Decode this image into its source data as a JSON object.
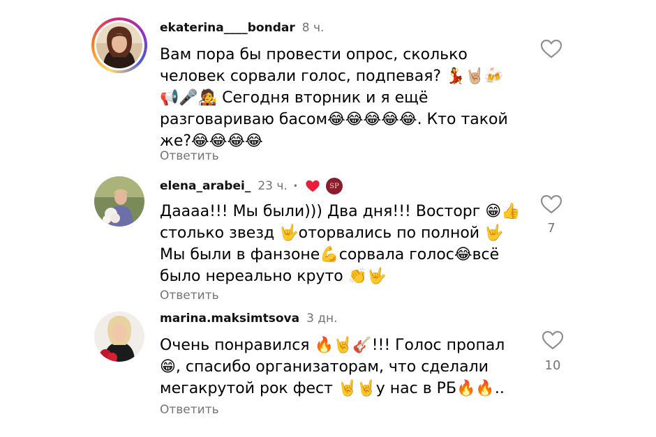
{
  "comments": [
    {
      "username": "ekaterina____bondar",
      "time": "8 ч.",
      "text": "Вам пора бы провести опрос, сколько человек сорвали голос, подпевая? 💃🤘🏼🍻 📢🎤🧑‍🎤 Сегодня вторник и я ещё разговариваю басом😂😂😂😂😂. Кто такой же?😂😂😂😂",
      "reply": "Ответить",
      "likes": "",
      "avatar_icon": "woman-portrait"
    },
    {
      "username": "elena_arabei_",
      "time": "23 ч.",
      "dot": "•",
      "creator_badge": "SP",
      "text": "Даааа!!! Мы были))) Два дня!!! Восторг 😁👍 столько звезд 🤟оторвались по полной 🤟 Мы были в фанзоне💪сорвала голос😂всё было нереально круто 👏🤟",
      "reply": "Ответить",
      "likes": "7",
      "avatar_icon": "woman-with-flowers"
    },
    {
      "username": "marina.maksimtsova",
      "time": "3 дн.",
      "text": "Очень понравился 🔥🤘🎸!!! Голос пропал 😁, спасибо организаторам, что сделали мегакрутой рок фест 🤘🤘у нас в РБ🔥🔥..",
      "reply": "Ответить",
      "likes": "10",
      "avatar_icon": "woman-with-roses"
    }
  ],
  "colors": {
    "secondary_text": "#737373",
    "liked_heart": "#ed1c3b",
    "ring_gradient": [
      "#feda75",
      "#fa7e1e",
      "#d62976",
      "#962fbf",
      "#4f5bd5"
    ]
  }
}
